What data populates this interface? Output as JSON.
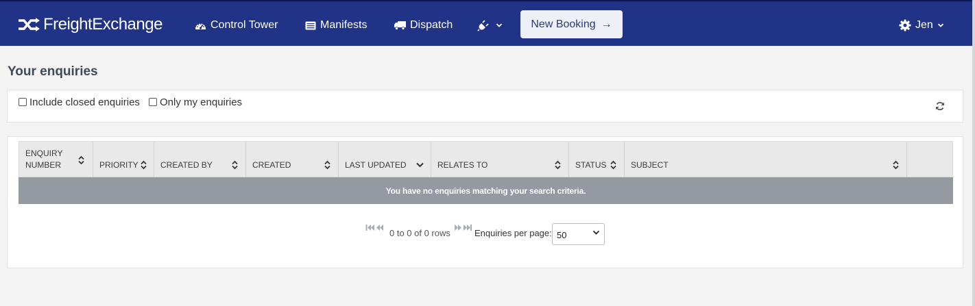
{
  "app": {
    "logo_text": "FreightExchange"
  },
  "nav": {
    "control_tower": "Control Tower",
    "manifests": "Manifests",
    "dispatch": "Dispatch",
    "new_booking": "New Booking",
    "new_booking_arrow": "→",
    "user": "Jen"
  },
  "page": {
    "title": "Your enquiries"
  },
  "filters": {
    "include_closed": "Include closed enquiries",
    "only_mine": "Only my enquiries"
  },
  "table": {
    "columns": [
      {
        "label": "ENQUIRY NUMBER",
        "sort": "both"
      },
      {
        "label": "PRIORITY",
        "sort": "both"
      },
      {
        "label": "CREATED BY",
        "sort": "both"
      },
      {
        "label": "CREATED",
        "sort": "both"
      },
      {
        "label": "LAST UPDATED",
        "sort": "desc"
      },
      {
        "label": "RELATES TO",
        "sort": "both"
      },
      {
        "label": "STATUS",
        "sort": "both"
      },
      {
        "label": "SUBJECT",
        "sort": "both"
      },
      {
        "label": "",
        "sort": "none"
      }
    ],
    "empty_message": "You have no enquiries matching your search criteria."
  },
  "pager": {
    "range_text": "0 to 0 of 0 rows",
    "per_page_label": "Enquiries per page:",
    "per_page_value": "50"
  },
  "colors": {
    "topbar": "#203387",
    "empty_row": "#959aa2"
  }
}
